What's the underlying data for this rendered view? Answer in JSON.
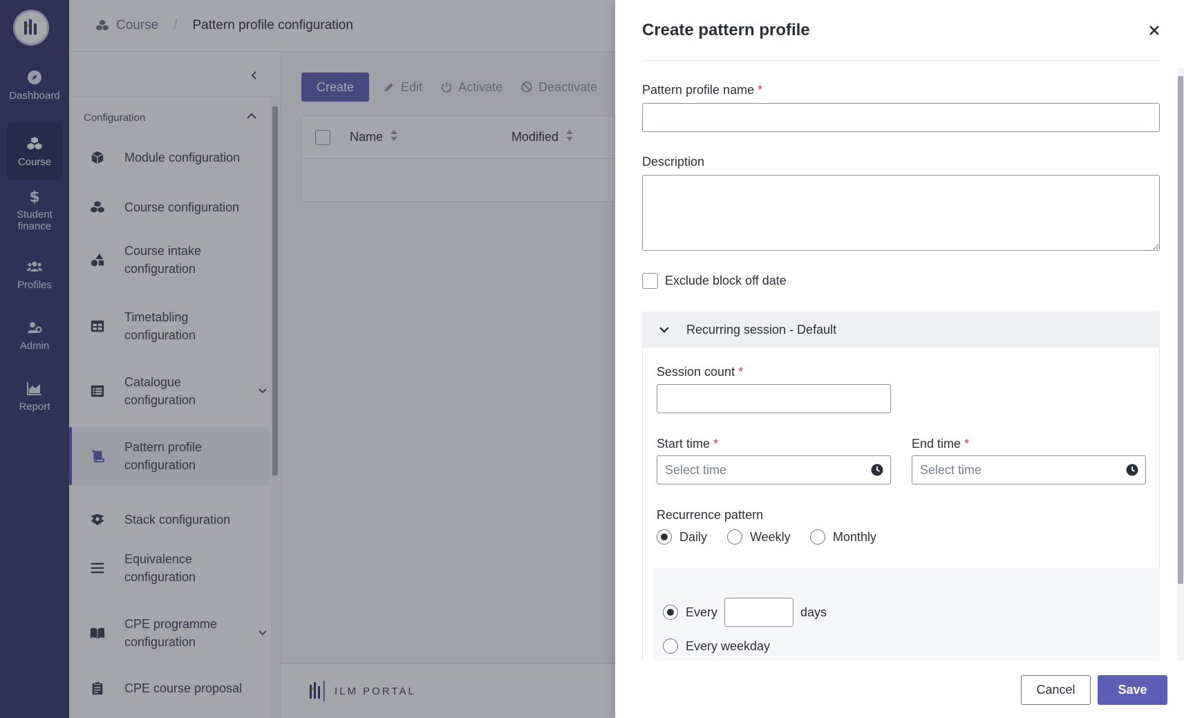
{
  "nav": {
    "items": [
      {
        "label": "Dashboard",
        "icon": "compass-icon"
      },
      {
        "label": "Course",
        "icon": "cubes-icon"
      },
      {
        "label": "Student finance",
        "icon": "dollar-icon"
      },
      {
        "label": "Profiles",
        "icon": "users-icon"
      },
      {
        "label": "Admin",
        "icon": "user-gear-icon"
      },
      {
        "label": "Report",
        "icon": "area-chart-icon"
      }
    ],
    "active": "Course"
  },
  "breadcrumb": {
    "root": "Course",
    "separator": "/",
    "current": "Pattern profile configuration"
  },
  "sidemenu": {
    "section": "Configuration",
    "items": [
      {
        "label": "Module configuration",
        "icon": "cube-icon"
      },
      {
        "label": "Course configuration",
        "icon": "cubes-icon"
      },
      {
        "label": "Course intake configuration",
        "icon": "shapes-icon"
      },
      {
        "label": "Timetabling configuration",
        "icon": "table-icon"
      },
      {
        "label": "Catalogue configuration",
        "icon": "list-icon"
      },
      {
        "label": "Pattern profile configuration",
        "icon": "scroll-icon"
      },
      {
        "label": "Stack configuration",
        "icon": "stack-icon"
      },
      {
        "label": "Equivalence configuration",
        "icon": "bars-icon"
      },
      {
        "label": "CPE programme configuration",
        "icon": "book-icon"
      },
      {
        "label": "CPE course proposal",
        "icon": "clipboard-icon"
      }
    ]
  },
  "toolbar": {
    "create": "Create",
    "edit": "Edit",
    "activate": "Activate",
    "deactivate": "Deactivate"
  },
  "table": {
    "columns": [
      "Name",
      "Modified"
    ]
  },
  "footer": {
    "brand": "ILM PORTAL"
  },
  "drawer": {
    "title": "Create pattern profile",
    "name_label": "Pattern profile name",
    "name_value": "",
    "description_label": "Description",
    "description_value": "",
    "exclude_label": "Exclude block off date",
    "accordion_title": "Recurring session - Default",
    "session_count_label": "Session count",
    "start_time_label": "Start time",
    "end_time_label": "End time",
    "time_placeholder": "Select time",
    "recurrence_label": "Recurrence pattern",
    "recurrence_options": [
      "Daily",
      "Weekly",
      "Monthly"
    ],
    "recurrence_selected": "Daily",
    "every_label": "Every",
    "days_label": "days",
    "every_weekday_label": "Every weekday",
    "cancel": "Cancel",
    "save": "Save"
  },
  "colors": {
    "nav_bg": "#34376a",
    "accent": "#5c5fb3",
    "required": "#d23b3b"
  }
}
